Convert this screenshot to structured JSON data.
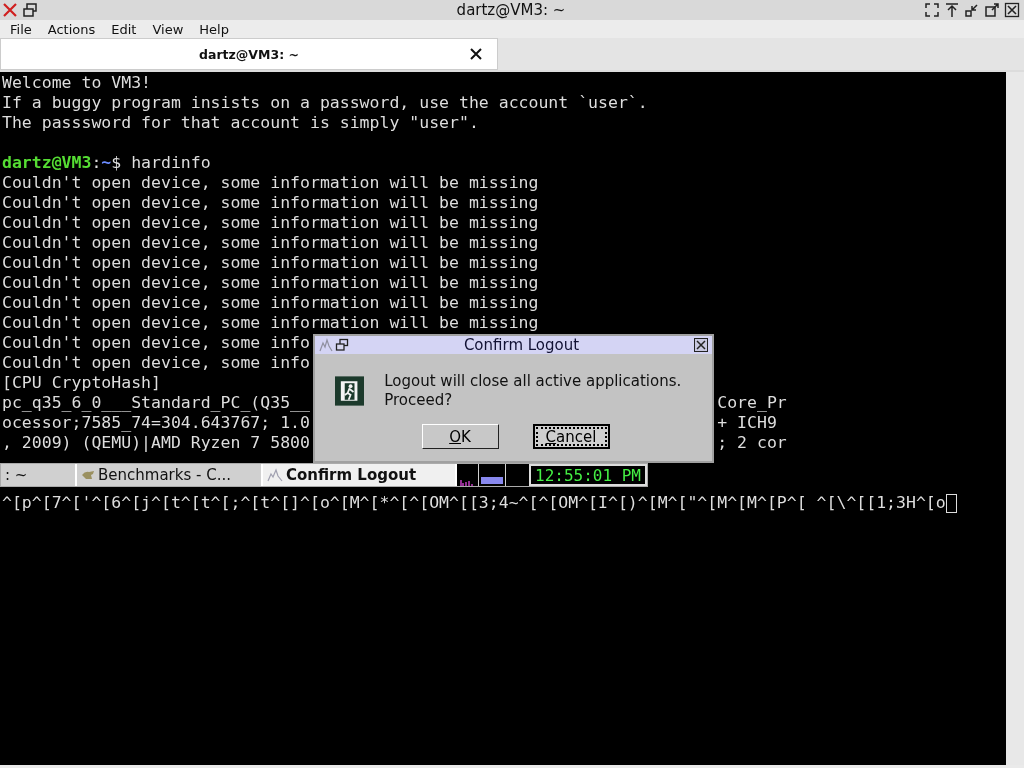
{
  "window": {
    "title": "dartz@VM3: ~"
  },
  "menu": [
    "File",
    "Actions",
    "Edit",
    "View",
    "Help"
  ],
  "tabs": [
    {
      "label": "dartz@VM3: ~",
      "selected": true
    }
  ],
  "terminal": {
    "lines": [
      {
        "kind": "text",
        "text": "Welcome to VM3!"
      },
      {
        "kind": "text",
        "text": "If a buggy program insists on a password, use the account `user`."
      },
      {
        "kind": "text",
        "text": "The passsword for that account is simply \"user\"."
      },
      {
        "kind": "blank"
      },
      {
        "kind": "prompt",
        "user": "dartz@VM3",
        "sep": ":",
        "path": "~",
        "symbol": "$",
        "command": "hardinfo"
      },
      {
        "kind": "text",
        "text": "Couldn't open device, some information will be missing"
      },
      {
        "kind": "text",
        "text": "Couldn't open device, some information will be missing"
      },
      {
        "kind": "text",
        "text": "Couldn't open device, some information will be missing"
      },
      {
        "kind": "text",
        "text": "Couldn't open device, some information will be missing"
      },
      {
        "kind": "text",
        "text": "Couldn't open device, some information will be missing"
      },
      {
        "kind": "text",
        "text": "Couldn't open device, some information will be missing"
      },
      {
        "kind": "text",
        "text": "Couldn't open device, some information will be missing"
      },
      {
        "kind": "text",
        "text": "Couldn't open device, some information will be missing"
      },
      {
        "kind": "text",
        "text": "Couldn't open device, some info"
      },
      {
        "kind": "text",
        "text": "Couldn't open device, some info"
      },
      {
        "kind": "text",
        "text": "[CPU CryptoHash]"
      },
      {
        "kind": "split",
        "text": "pc_q35_6_0___Standard_PC_(Q35__",
        "right": "Core_Pr"
      },
      {
        "kind": "split",
        "text": "ocessor;7585_74=304.643767; 1.0",
        "right": "+ ICH9"
      },
      {
        "kind": "split",
        "text": ", 2009) (QEMU)|AMD Ryzen 7 5800",
        "right": "; 2 cor"
      },
      {
        "kind": "input",
        "text": "^[p^[7^['^[6^[j^[t^[t^[;^[t^[]^[o^[M^[*^[^[OM^[[3;4~^[^[OM^[I^[)^[M^[\"^[M^[M^[P^[ ^[\\^[[1;3H^[o"
      }
    ]
  },
  "dialog": {
    "title": "Confirm Logout",
    "message": "Logout will close all active applications. Proceed?",
    "buttons": [
      {
        "label": "OK",
        "focused": false
      },
      {
        "label": "Cancel",
        "focused": true
      }
    ]
  },
  "taskbar": {
    "items": [
      {
        "label": ": ~",
        "kind": "plain",
        "selected": false
      },
      {
        "label": "Benchmarks - C...",
        "kind": "app",
        "selected": false
      },
      {
        "label": "Confirm Logout",
        "kind": "logout",
        "selected": true
      }
    ],
    "clock": "12:55:01 PM"
  }
}
